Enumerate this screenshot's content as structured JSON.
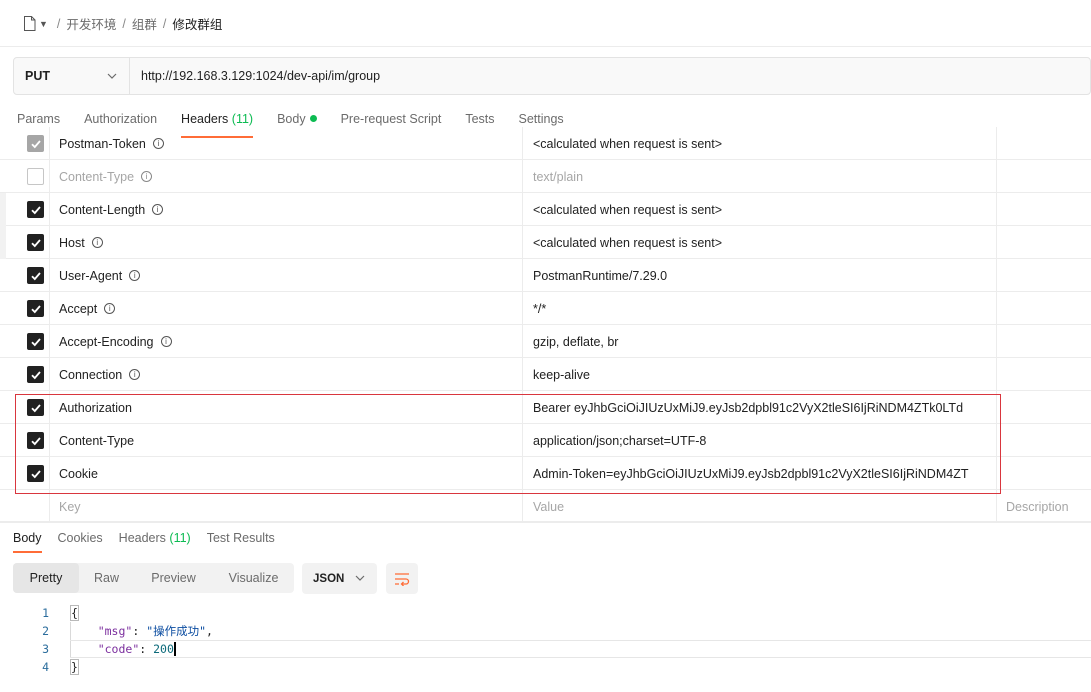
{
  "breadcrumb": {
    "items": [
      "开发环境",
      "组群"
    ],
    "current": "修改群组",
    "separator": "/"
  },
  "request": {
    "method": "PUT",
    "url": "http://192.168.3.129:1024/dev-api/im/group"
  },
  "request_tabs": {
    "params": "Params",
    "authorization": "Authorization",
    "headers": "Headers",
    "headers_count": "(11)",
    "body": "Body",
    "prerequest": "Pre-request Script",
    "tests": "Tests",
    "settings": "Settings"
  },
  "headers": [
    {
      "key": "Postman-Token",
      "value": "<calculated when request is sent>",
      "checked": "locked"
    },
    {
      "key": "Content-Type",
      "value": "text/plain",
      "checked": "off"
    },
    {
      "key": "Content-Length",
      "value": "<calculated when request is sent>",
      "checked": "on"
    },
    {
      "key": "Host",
      "value": "<calculated when request is sent>",
      "checked": "on"
    },
    {
      "key": "User-Agent",
      "value": "PostmanRuntime/7.29.0",
      "checked": "on"
    },
    {
      "key": "Accept",
      "value": "*/*",
      "checked": "on"
    },
    {
      "key": "Accept-Encoding",
      "value": "gzip, deflate, br",
      "checked": "on"
    },
    {
      "key": "Connection",
      "value": "keep-alive",
      "checked": "on"
    },
    {
      "key": "Authorization",
      "value": "Bearer eyJhbGciOiJIUzUxMiJ9.eyJsb2dpbl91c2VyX2tleSI6IjRiNDM4ZTk0LTd",
      "checked": "on"
    },
    {
      "key": "Content-Type",
      "value": "application/json;charset=UTF-8",
      "checked": "on"
    },
    {
      "key": "Cookie",
      "value": "Admin-Token=eyJhbGciOiJIUzUxMiJ9.eyJsb2dpbl91c2VyX2tleSI6IjRiNDM4ZT",
      "checked": "on"
    }
  ],
  "header_placeholders": {
    "key": "Key",
    "value": "Value",
    "description": "Description"
  },
  "response_tabs": {
    "body": "Body",
    "cookies": "Cookies",
    "headers": "Headers",
    "headers_count": "(11)",
    "test_results": "Test Results"
  },
  "formats": [
    "Pretty",
    "Raw",
    "Preview",
    "Visualize"
  ],
  "format_selected": "Pretty",
  "language": "JSON",
  "response_code": {
    "lines": [
      "1",
      "2",
      "3",
      "4"
    ],
    "open_brace": "{",
    "close_brace": "}",
    "msg_key": "\"msg\"",
    "msg_value": "\"操作成功\"",
    "code_key": "\"code\"",
    "code_value": "200"
  },
  "colors": {
    "accent": "#ff6c37",
    "success": "#0cbb52",
    "highlight_box": "#d9363e"
  },
  "icons": {
    "breadcrumb": "document-icon",
    "dropdown": "chevron-down-icon",
    "info": "info-icon",
    "wrap": "wrap-lines-icon"
  }
}
